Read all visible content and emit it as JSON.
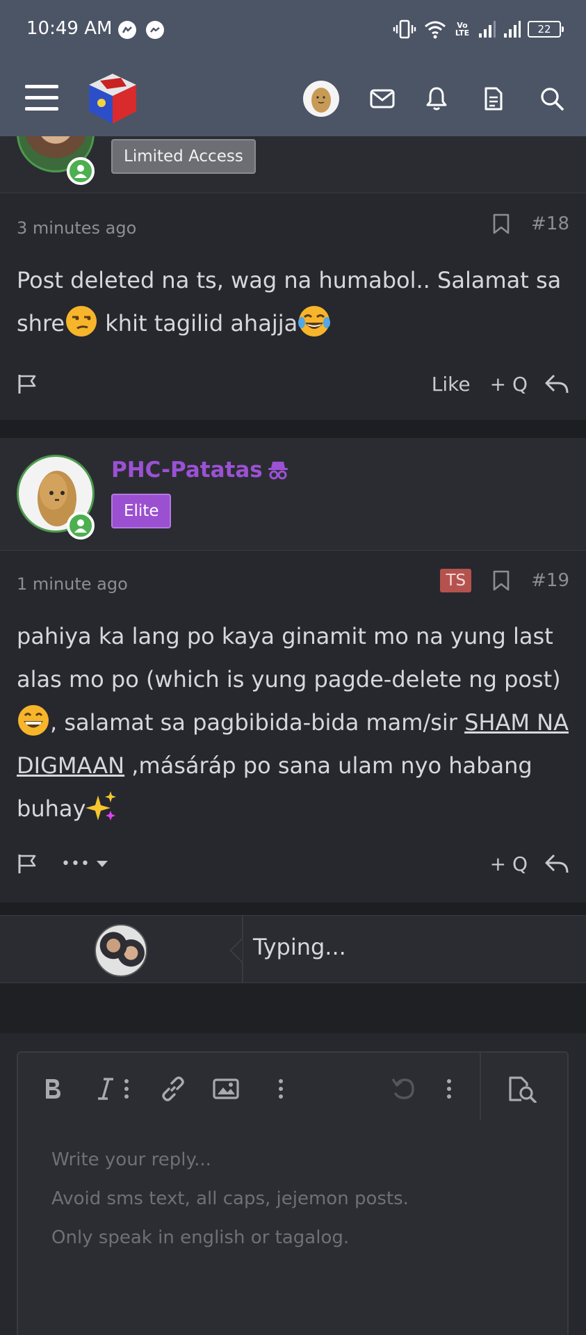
{
  "status_bar": {
    "time": "10:49 AM",
    "volte": "Vo LTE",
    "battery": "22"
  },
  "header": {
    "menu_icon": "hamburger-menu-icon",
    "logo_icon": "philippine-flag-cube-logo",
    "icons": [
      "potato-avatar",
      "envelope-icon",
      "bell-icon",
      "document-icon",
      "search-icon"
    ]
  },
  "post18": {
    "badge": "Limited Access",
    "time": "3 minutes ago",
    "number": "#18",
    "text_parts": [
      "Post deleted na ts, wag na humabol.. Salamat sa shre",
      " khit tagilid ahajja"
    ],
    "emoji_1": "unamused-face",
    "emoji_2": "tears-of-joy-face",
    "actions": {
      "like": "Like",
      "quote": "+ Q"
    }
  },
  "post19": {
    "username": "PHC-Patatas",
    "badge": "Elite",
    "time": "1 minute ago",
    "ts_badge": "TS",
    "number": "#19",
    "text_parts": [
      "pahiya ka lang po kaya ginamit mo na yung last alas mo po (which is yung pagde-delete ng post) ",
      ", salamat sa pagbibida-bida mam/sir ",
      "SHAM NA DIGMAAN",
      " ,másáráp po sana ulam nyo habang buhay"
    ],
    "emoji_1": "grinning-face",
    "emoji_2": "sparkles",
    "actions": {
      "more": "•••",
      "quote": "+ Q"
    }
  },
  "typing": {
    "text": "Typing..."
  },
  "editor": {
    "toolbar": [
      "bold",
      "italic",
      "more",
      "link",
      "image",
      "more",
      "undo",
      "more",
      "preview"
    ],
    "placeholder": "Write your reply...\nAvoid sms text, all caps, jejemon posts.\nOnly speak in english or tagalog."
  },
  "colors": {
    "header_bg": "#4c5566",
    "page_bg": "#27282d",
    "username": "#9b51d4",
    "elite_badge": "#9b4fd1",
    "ts_badge": "#b5524e",
    "online": "#4caf50"
  }
}
